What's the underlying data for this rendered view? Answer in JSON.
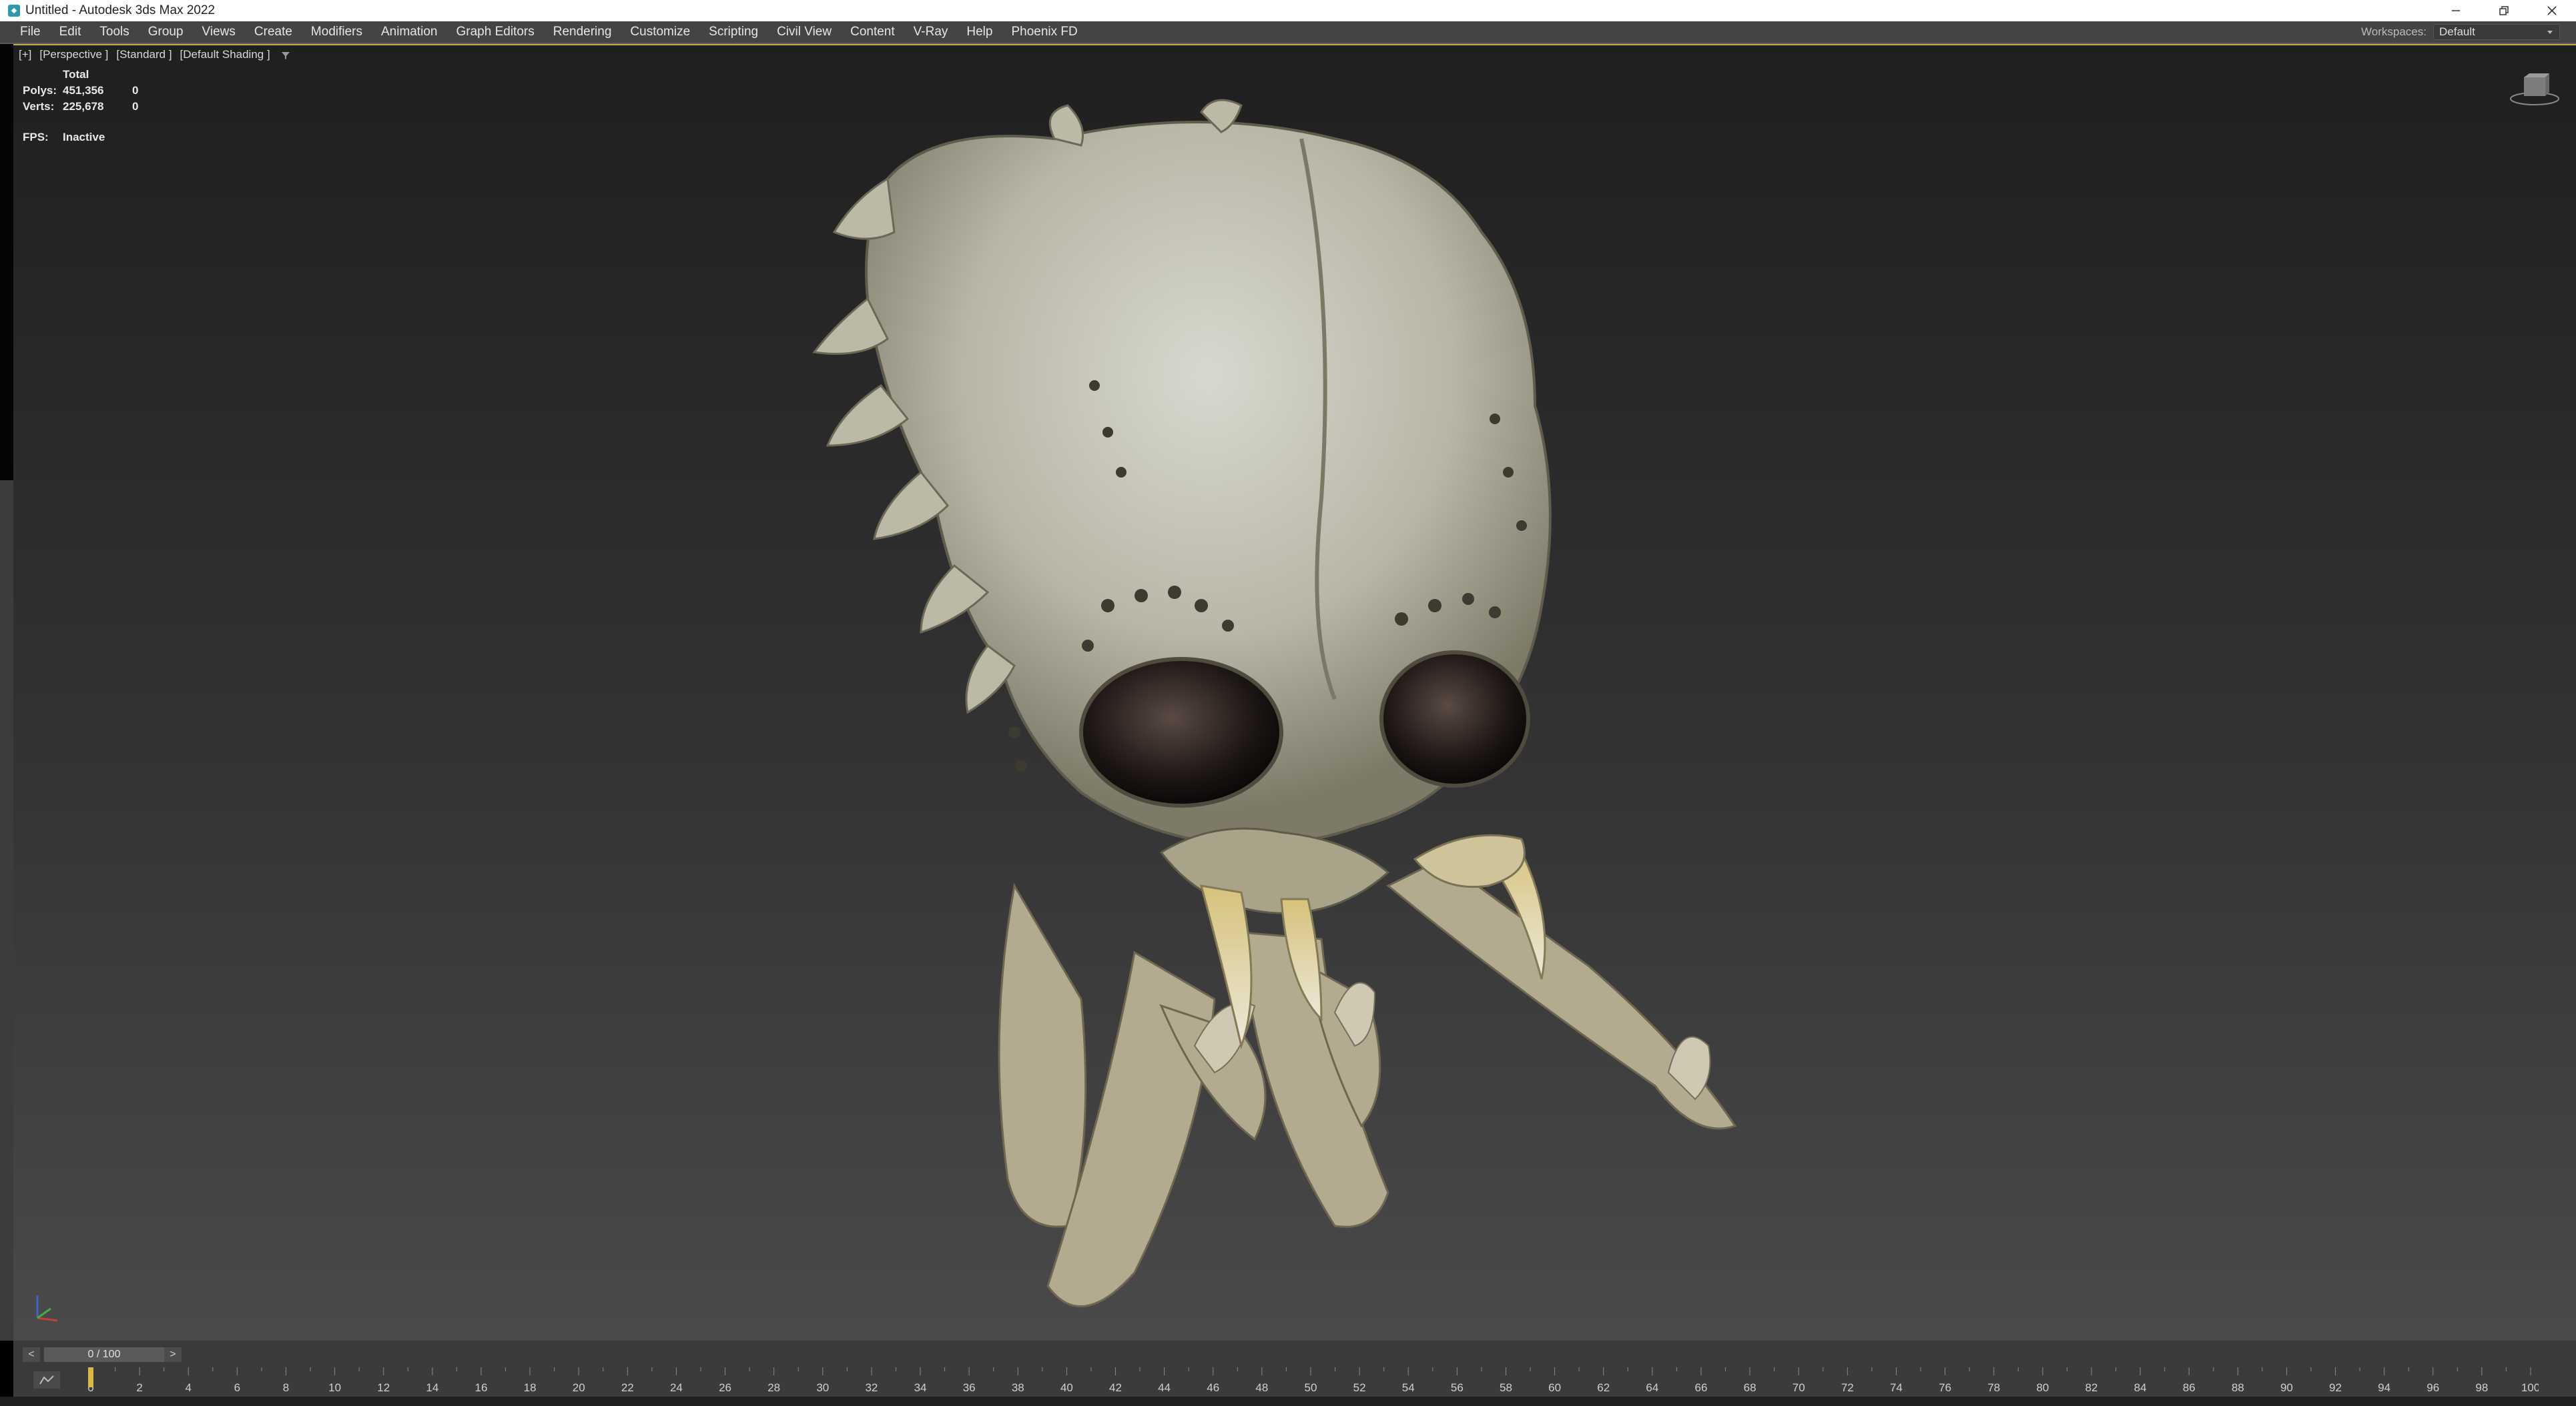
{
  "window": {
    "title": "Untitled - Autodesk 3ds Max 2022",
    "controls": [
      "minimize",
      "restore",
      "close"
    ]
  },
  "menu": {
    "items": [
      "File",
      "Edit",
      "Tools",
      "Group",
      "Views",
      "Create",
      "Modifiers",
      "Animation",
      "Graph Editors",
      "Rendering",
      "Customize",
      "Scripting",
      "Civil View",
      "Content",
      "V-Ray",
      "Help",
      "Phoenix FD"
    ],
    "workspaces_label": "Workspaces:",
    "workspaces_value": "Default"
  },
  "viewport": {
    "labels": [
      "[+]",
      "[Perspective ]",
      "[Standard ]",
      "[Default Shading ]"
    ],
    "stats": {
      "header": "Total",
      "polys_label": "Polys:",
      "polys_value": "451,356",
      "polys_selected": "0",
      "verts_label": "Verts:",
      "verts_value": "225,678",
      "verts_selected": "0"
    },
    "fps_label": "FPS:",
    "fps_value": "Inactive"
  },
  "timeline": {
    "position": "0 / 100",
    "prev": "<",
    "next": ">",
    "ticks": [
      "0",
      "2",
      "4",
      "6",
      "8",
      "10",
      "12",
      "14",
      "16",
      "18",
      "20",
      "22",
      "24",
      "26",
      "28",
      "30",
      "32",
      "34",
      "36",
      "38",
      "40",
      "42",
      "44",
      "46",
      "48",
      "50",
      "52",
      "54",
      "56",
      "58",
      "60",
      "62",
      "64",
      "66",
      "68",
      "70",
      "72",
      "74",
      "76",
      "78",
      "80",
      "82",
      "84",
      "86",
      "88",
      "90",
      "92",
      "94",
      "96",
      "98",
      "100"
    ]
  },
  "colors": {
    "accent_frame": "#c8a84e",
    "menu_bg": "#444444",
    "viewport_top": "#1f1f1f",
    "viewport_bottom": "#4a4a4a"
  }
}
